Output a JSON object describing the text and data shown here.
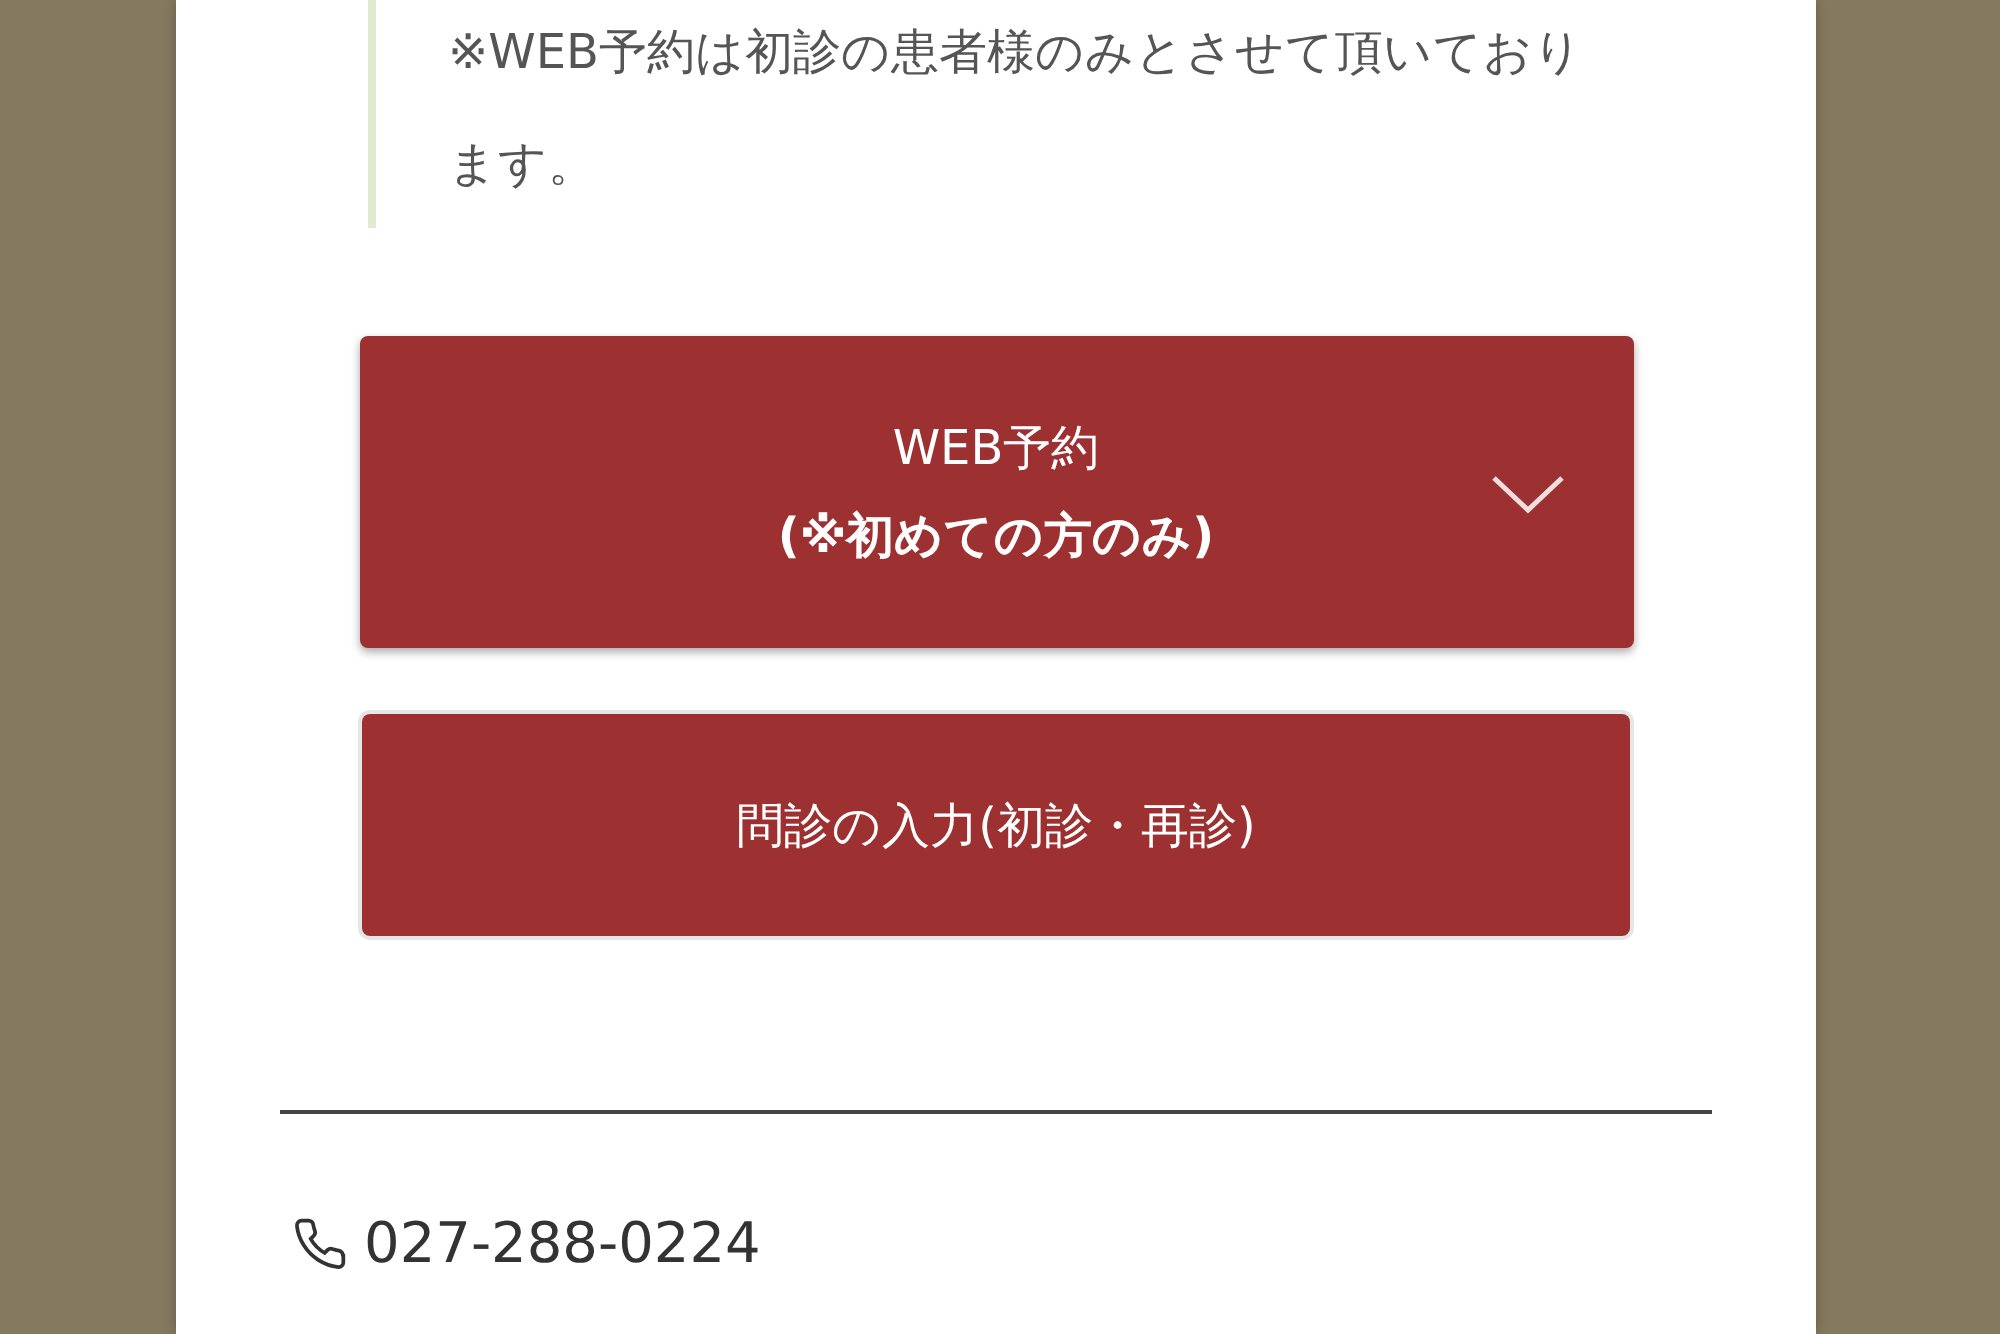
{
  "notice": {
    "text": "※WEB予約は初診の患者様のみとさせて頂いております。"
  },
  "buttons": [
    {
      "kind": "dropdown",
      "label": "WEB予約",
      "sublabel": "(※初めての方のみ)",
      "expanded": false
    },
    {
      "kind": "link",
      "label": "問診の入力(初診・再診)"
    }
  ],
  "contact": {
    "phone": "027-288-0224"
  }
}
